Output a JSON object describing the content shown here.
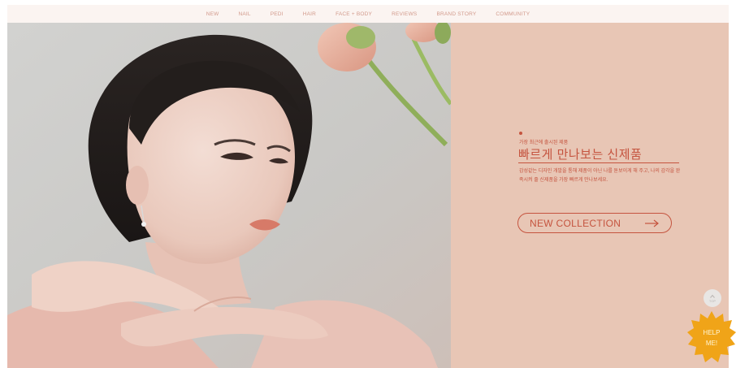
{
  "nav": {
    "items": [
      "NEW",
      "NAIL",
      "PEDI",
      "HAIR",
      "FACE + BODY",
      "REVIEWS",
      "BRAND STORY",
      "COMMUNITY"
    ]
  },
  "promo": {
    "kicker": "가장 최근에 출시된 제품",
    "headline": "빠르게 만나보는 신제품",
    "description": "감성같는 디자인 개발을 통해 제품이 아닌 나를 돋보이게 해 주고, 나의 감각을 완족시켜 줄 신제품을 가장 빠르게 만나보세요.",
    "cta_label": "NEW COLLECTION"
  },
  "floating": {
    "top_label": "TOP",
    "help_line1": "HELP",
    "help_line2": "ME!"
  },
  "colors": {
    "nav_bg": "#fbf4f1",
    "nav_text": "#d29a8c",
    "panel_bg": "#e8c6b5",
    "accent": "#c5543f",
    "help_badge": "#f0a418"
  },
  "icons": {
    "cta_arrow": "arrow-right-icon",
    "top_arrow": "chevron-up-icon",
    "help_shape": "starburst-badge"
  }
}
